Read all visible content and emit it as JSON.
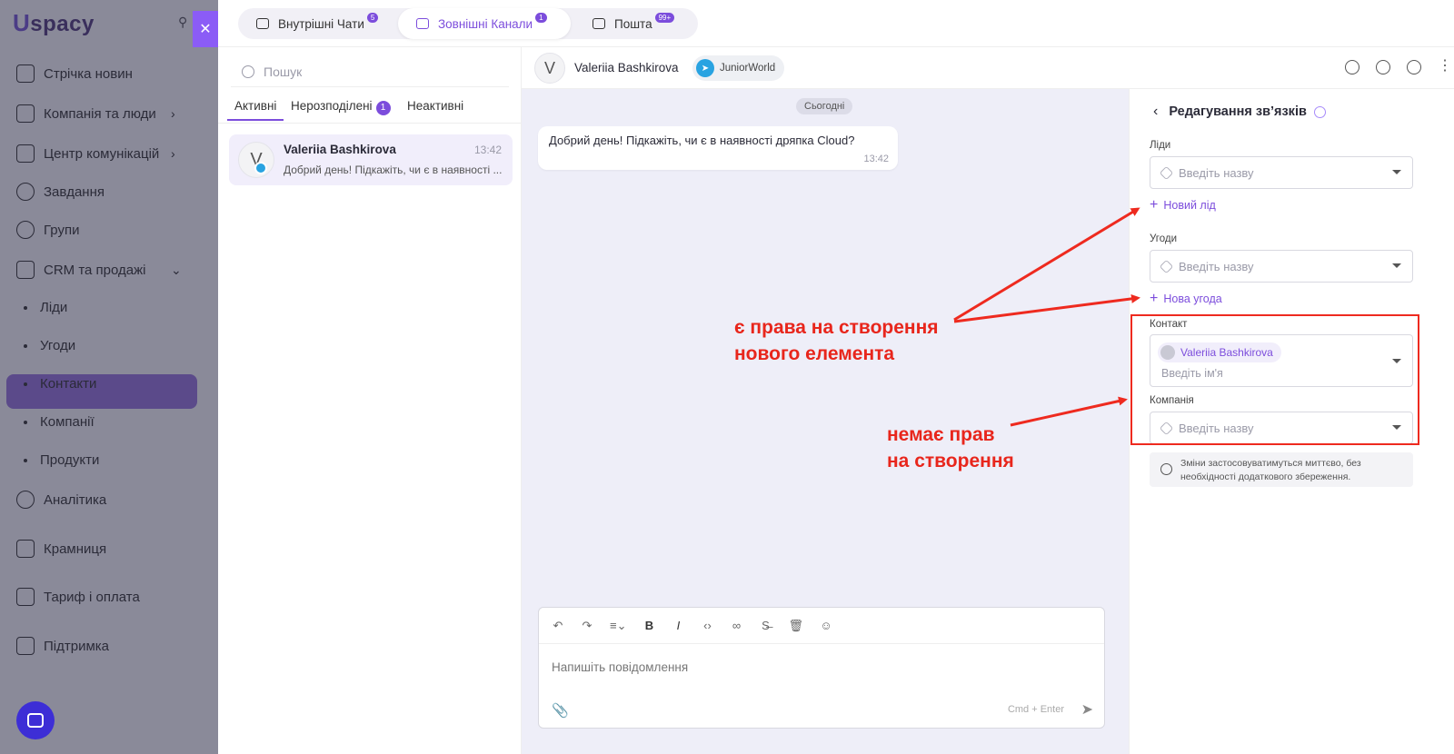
{
  "sidebar": {
    "logo": "spacy",
    "logo_prefix": "U",
    "items": [
      {
        "label": "Стрічка новин",
        "icon": "home-icon"
      },
      {
        "label": "Компанія та люди",
        "icon": "building-icon"
      },
      {
        "label": "Центр комунікацій",
        "icon": "chat-icon"
      },
      {
        "label": "Завдання",
        "icon": "check-circle-icon"
      },
      {
        "label": "Групи",
        "icon": "users-icon"
      },
      {
        "label": "CRM та продажі",
        "icon": "layers-icon"
      },
      {
        "label": "Ліди"
      },
      {
        "label": "Угоди"
      },
      {
        "label": "Контакти"
      },
      {
        "label": "Компанії"
      },
      {
        "label": "Продукти"
      },
      {
        "label": "Аналітика",
        "icon": "chart-icon"
      },
      {
        "label": "Крамниця",
        "icon": "store-icon"
      },
      {
        "label": "Тариф і оплата",
        "icon": "wallet-icon"
      },
      {
        "label": "Підтримка",
        "icon": "help-icon"
      }
    ]
  },
  "topbar": {
    "tabs": [
      {
        "label": "Внутрішні Чати",
        "badge": "5"
      },
      {
        "label": "Зовнішні Канали",
        "badge": "1"
      },
      {
        "label": "Пошта",
        "badge": "99+"
      }
    ]
  },
  "convlist": {
    "search_placeholder": "Пошук",
    "tabs": [
      {
        "label": "Активні"
      },
      {
        "label": "Нерозподілені",
        "count": "1"
      },
      {
        "label": "Неактивні"
      }
    ],
    "item": {
      "avatar": "V",
      "name": "Valeriia Bashkirova",
      "time": "13:42",
      "preview": "Добрий день! Підкажіть, чи є в наявності ..."
    }
  },
  "chat": {
    "avatar": "V",
    "name": "Valeriia Bashkirova",
    "channel": "JuniorWorld",
    "date_badge": "Сьогодні",
    "message": {
      "text": "Добрий день! Підкажіть, чи є в наявності дряпка Cloud?",
      "time": "13:42"
    },
    "composer": {
      "placeholder": "Напишіть повідомлення",
      "hint": "Cmd + Enter"
    }
  },
  "rpanel": {
    "title": "Редагування зв’язків",
    "leads_label": "Ліди",
    "leads_placeholder": "Введіть назву",
    "new_lead": "Новий лід",
    "deals_label": "Угоди",
    "deals_placeholder": "Введіть назву",
    "new_deal": "Нова угода",
    "contact_label": "Контакт",
    "contact_chip": "Valeriia Bashkirova",
    "contact_placeholder": "Введіть ім'я",
    "company_label": "Компанія",
    "company_placeholder": "Введіть назву",
    "notice": "Зміни застосовуватимуться миттєво, без необхідності додаткового збереження."
  },
  "annotations": {
    "has_rights_1": "є права на створення",
    "has_rights_2": "нового елемента",
    "no_rights_1": "немає прав",
    "no_rights_2": "на створення",
    "color": "#e8261c"
  }
}
